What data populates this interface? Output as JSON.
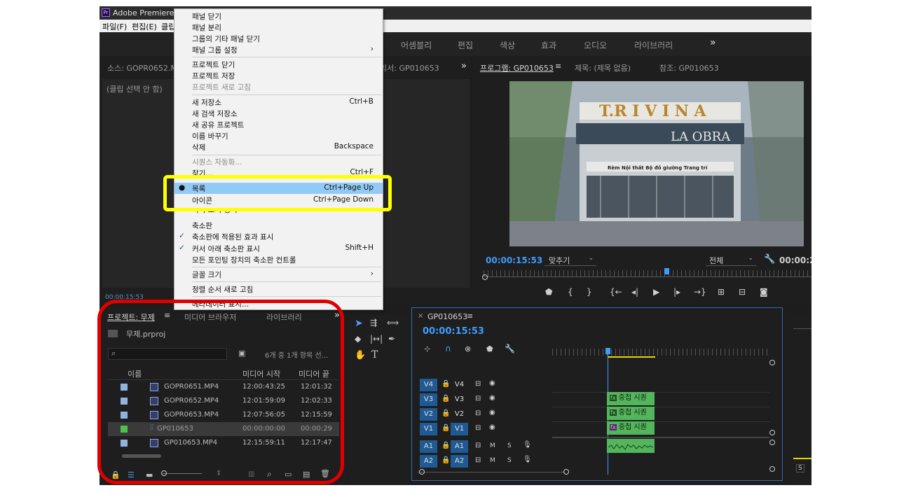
{
  "app": {
    "title": "Adobe Premiere Pro",
    "menubar": [
      "파일(F)",
      "편집(E)",
      "클립"
    ],
    "workspaces": [
      "어셈블리",
      "편집",
      "색상",
      "효과",
      "오디오",
      "라이브러리"
    ],
    "workspace_more": "»"
  },
  "source_panel": {
    "tab": "소스: GOPR0652.MP4",
    "tab_mixer": "믹서: GP010653",
    "more": "»",
    "no_clip": "(클립 선택 안 함)",
    "timecode": "00:00:15:53"
  },
  "program_panel": {
    "tab": "프로그램: GP010653",
    "menu_icon": "≡",
    "title_tab": "제목: (제목 없음)",
    "ref_tab": "참조: GP010653",
    "timecode": "00:00:15:53",
    "fit": "맞추기",
    "quality": "전체",
    "timecode_right": "00:00:2",
    "frame_sign": "T.R I V I N A",
    "frame_sign2": "LA OBRA",
    "frame_sign3": "Rèm  Nội thất  Bộ đồ giường  Trang trí"
  },
  "project_panel": {
    "tab": "프로젝트: 무제",
    "menu_icon": "≡",
    "tab_media": "미디어 브라우저",
    "tab_library": "라이브러리",
    "more": "»",
    "file": "무제.prproj",
    "search_placeholder": "",
    "count": "6개 중 1개 항목 선...",
    "col_name": "이름",
    "col_start": "미디어 시작",
    "col_end": "미디어 끝",
    "items": [
      {
        "name": "GOPR0651.MP4",
        "start": "12:00:43:25",
        "end": "12:01:32",
        "color": "#8fb4e0"
      },
      {
        "name": "GOPR0652.MP4",
        "start": "12:01:59:09",
        "end": "12:02:33",
        "color": "#8fb4e0"
      },
      {
        "name": "GOPR0653.MP4",
        "start": "12:07:56:05",
        "end": "12:15:59",
        "color": "#8fb4e0"
      },
      {
        "name": "GP010653",
        "start": "00:00:00:00",
        "end": "00:00:29",
        "color": "#4fc04f"
      },
      {
        "name": "GP010653.MP4",
        "start": "12:15:59:11",
        "end": "12:17:47",
        "color": "#8fb4e0"
      }
    ]
  },
  "timeline": {
    "tab": "GP010653",
    "close": "×",
    "menu_icon": "≡",
    "timecode": "00:00:15:53",
    "tracks": [
      {
        "id": "V4",
        "label": "V4"
      },
      {
        "id": "V3",
        "label": "V3"
      },
      {
        "id": "V2",
        "label": "V2"
      },
      {
        "id": "V1",
        "label": "V1"
      },
      {
        "id": "A1",
        "label": "A1",
        "m": "M",
        "s": "S"
      },
      {
        "id": "A2",
        "label": "A2",
        "m": "M",
        "s": "S"
      }
    ],
    "clip_label": "중첩 시퀀",
    "fx": "fx"
  },
  "context_menu": {
    "items": [
      {
        "label": "패널 닫기",
        "shortcut": ""
      },
      {
        "label": "패널 분리",
        "shortcut": ""
      },
      {
        "label": "그룹의 기타 패널 닫기",
        "shortcut": ""
      },
      {
        "label": "패널 그룹 설정",
        "shortcut": "›"
      },
      {
        "label": "프로젝트 닫기",
        "shortcut": ""
      },
      {
        "label": "프로젝트 저장",
        "shortcut": ""
      },
      {
        "label": "프로젝트 새로 고침",
        "shortcut": ""
      },
      {
        "label": "새 저장소",
        "shortcut": "Ctrl+B"
      },
      {
        "label": "새 검색 저장소",
        "shortcut": ""
      },
      {
        "label": "새 공유 프로젝트",
        "shortcut": ""
      },
      {
        "label": "이름 바꾸기",
        "shortcut": ""
      },
      {
        "label": "삭제",
        "shortcut": "Backspace"
      },
      {
        "label": "시퀀스 자동화...",
        "shortcut": ""
      },
      {
        "label": "찾기...",
        "shortcut": "Ctrl+F"
      },
      {
        "label": "목록",
        "shortcut": "Ctrl+Page Up"
      },
      {
        "label": "아이콘",
        "shortcut": "Ctrl+Page Down"
      },
      {
        "label": "미리 보기 영역",
        "shortcut": ""
      },
      {
        "label": "축소판",
        "shortcut": ""
      },
      {
        "label": "축소판에 적용된 효과 표시",
        "shortcut": ""
      },
      {
        "label": "커서 아래 축소판 표시",
        "shortcut": "Shift+H"
      },
      {
        "label": "모든 포인팅 장치의 축소판 컨트롤",
        "shortcut": ""
      },
      {
        "label": "글꼴 크기",
        "shortcut": "›"
      },
      {
        "label": "정렬 순서 새로 고침",
        "shortcut": ""
      },
      {
        "label": "메타데이터 표시...",
        "shortcut": ""
      }
    ]
  },
  "annotations": {
    "highlight_color": "#ffff00",
    "circle_color": "#e00000"
  }
}
